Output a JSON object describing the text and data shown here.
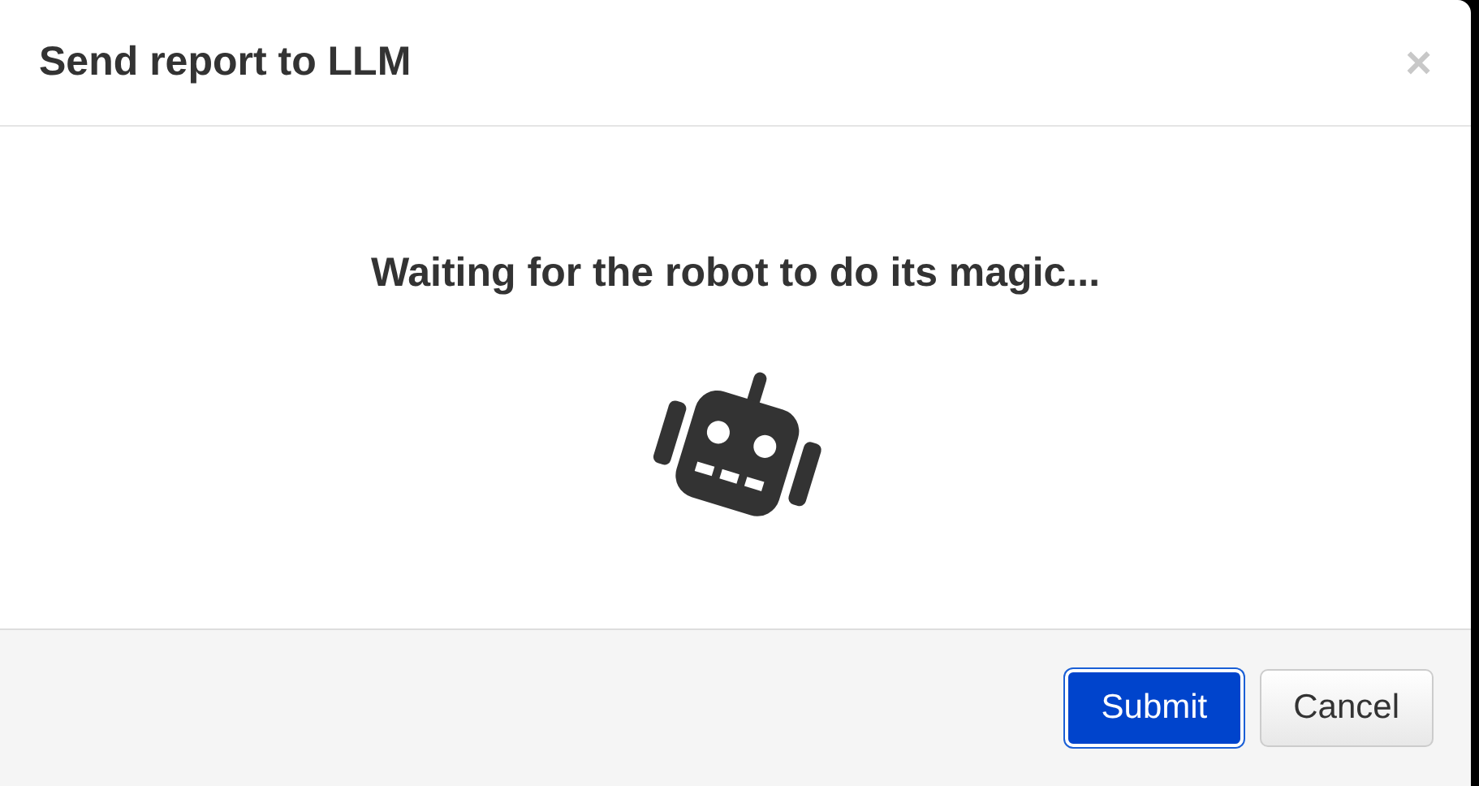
{
  "dialog": {
    "title": "Send report to LLM",
    "close": "×",
    "message": "Waiting for the robot to do its magic...",
    "buttons": [
      {
        "label": "Submit",
        "kind": "primary"
      },
      {
        "label": "Cancel",
        "kind": "default"
      }
    ]
  }
}
